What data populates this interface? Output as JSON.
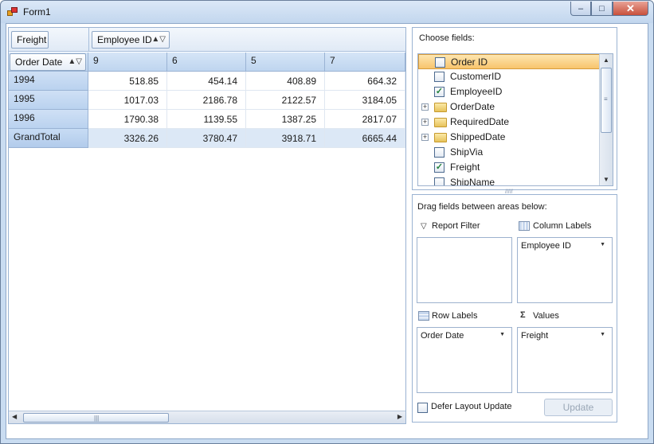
{
  "window": {
    "title": "Form1",
    "minimize": "–",
    "maximize": "□",
    "close": "✕"
  },
  "pivot": {
    "data_field": "Freight",
    "column_field": "Employee ID",
    "row_field": "Order Date",
    "column_headers": [
      "9",
      "6",
      "5",
      "7"
    ],
    "rows": [
      {
        "label": "1994",
        "values": [
          "518.85",
          "454.14",
          "408.89",
          "664.32"
        ]
      },
      {
        "label": "1995",
        "values": [
          "1017.03",
          "2186.78",
          "2122.57",
          "3184.05"
        ]
      },
      {
        "label": "1996",
        "values": [
          "1790.38",
          "1139.55",
          "1387.25",
          "2817.07"
        ]
      }
    ],
    "total": {
      "label": "GrandTotal",
      "values": [
        "3326.26",
        "3780.47",
        "3918.71",
        "6665.44"
      ]
    }
  },
  "field_list": {
    "caption": "Choose fields:",
    "fields": [
      {
        "label": "Order ID",
        "type": "field",
        "checked": false,
        "selected": true
      },
      {
        "label": "CustomerID",
        "type": "field",
        "checked": false,
        "selected": false
      },
      {
        "label": "EmployeeID",
        "type": "field",
        "checked": true,
        "selected": false
      },
      {
        "label": "OrderDate",
        "type": "folder",
        "checked": false,
        "selected": false
      },
      {
        "label": "RequiredDate",
        "type": "folder",
        "checked": false,
        "selected": false
      },
      {
        "label": "ShippedDate",
        "type": "folder",
        "checked": false,
        "selected": false
      },
      {
        "label": "ShipVia",
        "type": "field",
        "checked": false,
        "selected": false
      },
      {
        "label": "Freight",
        "type": "field",
        "checked": true,
        "selected": false
      },
      {
        "label": "ShipName",
        "type": "field",
        "checked": false,
        "selected": false
      }
    ]
  },
  "areas": {
    "caption": "Drag fields between areas below:",
    "report_filter": {
      "label": "Report Filter",
      "items": []
    },
    "column_labels": {
      "label": "Column Labels",
      "items": [
        "Employee ID"
      ]
    },
    "row_labels": {
      "label": "Row Labels",
      "items": [
        "Order Date"
      ]
    },
    "values": {
      "label": "Values",
      "items": [
        "Freight"
      ]
    }
  },
  "footer": {
    "defer_label": "Defer Layout Update",
    "update_label": "Update"
  },
  "colors": {
    "accent": "#f8c46c",
    "header_blue": "#bfd5ef",
    "total_row": "#dce8f6"
  }
}
